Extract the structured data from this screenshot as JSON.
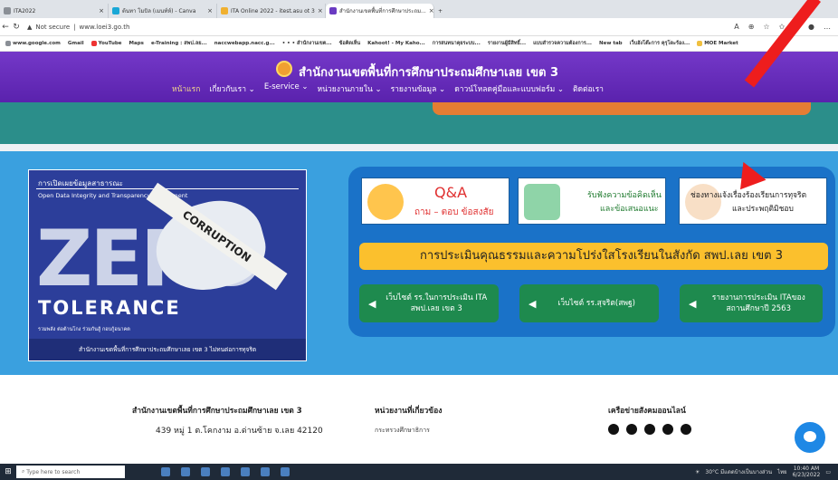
{
  "browser": {
    "tabs": [
      {
        "label": "ITA2022"
      },
      {
        "label": "ต้นทา โมบิล (เมนท์ห์) - Canva"
      },
      {
        "label": "ITA Online 2022 - itest.asu ot 3"
      },
      {
        "label": "สำนักงานเขตพื้นที่การศึกษาประถม..."
      }
    ],
    "security": "Not secure",
    "url": "www.loei3.go.th",
    "bookmarks": [
      "www.google.com",
      "Gmail",
      "YouTube",
      "Maps",
      "e-Training : สพป.ลย...",
      "naccwebapp.nacc.g...",
      "• • • สำนักงานเขต...",
      "ข้อคิดเห็น",
      "Kahoot! - My Kaho...",
      "การสนทนาคุยระบบ...",
      "รายงานผู้มีสิทธิ์...",
      "แบบสำรวจความต้องการ...",
      "New tab",
      "เว็บฮังโต๊ะการ คุรุโดะร้อง...",
      "MOE Market"
    ]
  },
  "site": {
    "title": "สำนักงานเขตพื้นที่การศึกษาประถมศึกษาเลย เขต 3",
    "menu": [
      {
        "label": "หน้าแรก",
        "selected": true
      },
      {
        "label": "เกี่ยวกับเรา ⌄"
      },
      {
        "label": "E-service ⌄"
      },
      {
        "label": "หน่วยงานภายใน ⌄"
      },
      {
        "label": "รายงานข้อมูล ⌄"
      },
      {
        "label": "ดาวน์โหลดคู่มือและแบบฟอร์ม ⌄"
      },
      {
        "label": "ติดต่อเรา"
      }
    ]
  },
  "poster": {
    "title": "การเปิดเผยข้อมูลสาธารณะ",
    "subtitle": "Open Data Integrity and Transparency Assessment",
    "zero": "ZERO",
    "tape": "CORRUPTION",
    "tolerance": "TOLERANCE",
    "tagline": "รวมพลัง ต่อต้านโกง ร่วมกันสู้ กอบกู้อนาคต",
    "footer": "สำนักงานเขตพื้นที่การศึกษาประถมศึกษาเลย เขต 3 ไม่ทนต่อการทุจริต"
  },
  "panel": {
    "qa_title": "Q&A",
    "qa_sub": "ถาม – ตอบ ข้อสงสัย",
    "opinion_line1": "รับฟังความข้อคิดเห็น",
    "opinion_line2": "และข้อเสนอแนะ",
    "complaint_line1": "ช่องทางแจ้งเรื่องร้องเรียนการทุจริต",
    "complaint_line2": "และประพฤติมิชอบ",
    "banner": "การประเมินคุณธรรมและความโปร่งใสโรงเรียนในสังกัด สพป.เลย เขต 3",
    "buttons": [
      {
        "label": "เว็บไซต์ รร.ในการประเมิน ITA สพป.เลย เขต 3"
      },
      {
        "label": "เว็บไซต์ รร.สุจริต(สพฐ)"
      },
      {
        "label": "รายงานการประเมิน ITAของสถานศึกษาปี 2563"
      }
    ]
  },
  "footer": {
    "col1_title": "สำนักงานเขตพื้นที่การศึกษาประถมศึกษาเลย เขต 3",
    "address": "439 หมู่ 1 ต.โคกงาม อ.ด่านซ้าย จ.เลย 42120",
    "col2_title": "หน่วยงานที่เกี่ยวข้อง",
    "col2_link": "กระทรวงศึกษาธิการ",
    "col3_title": "เครือข่ายสังคมออนไลน์"
  },
  "taskbar": {
    "search_placeholder": "Type here to search",
    "weather": "30°C มีแดดบ้างเป็นบางส่วน",
    "time": "10:40 AM",
    "date": "6/23/2022",
    "lang": "ไทย"
  }
}
